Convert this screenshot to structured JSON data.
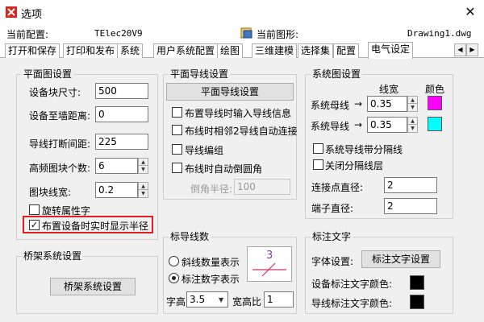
{
  "window": {
    "title": "选项",
    "close_glyph": "✕"
  },
  "info": {
    "current_config_label": "当前配置:",
    "current_config_value": "TElec20V9",
    "current_drawing_label": "当前图形:",
    "current_drawing_value": "Drawing1.dwg"
  },
  "tabs": [
    {
      "label": "打开和保存",
      "active": false
    },
    {
      "label": "打印和发布",
      "active": false
    },
    {
      "label": "系统",
      "active": false
    },
    {
      "label": "用户系统配置",
      "active": false
    },
    {
      "label": "绘图",
      "active": false
    },
    {
      "label": "三维建模",
      "active": false
    },
    {
      "label": "选择集",
      "active": false
    },
    {
      "label": "配置",
      "active": false
    },
    {
      "label": "电气设定",
      "active": true
    }
  ],
  "tab_arrows": {
    "left": "◀",
    "right": "▶"
  },
  "plane": {
    "title": "平面图设置",
    "fields": [
      {
        "label": "设备块尺寸:",
        "value": "500"
      },
      {
        "label": "设备至墙距离:",
        "value": "0"
      },
      {
        "label": "导线打断间距:",
        "value": "225"
      },
      {
        "label": "高频图块个数:",
        "value": "6"
      },
      {
        "label": "图块线宽:",
        "value": "0.2"
      }
    ],
    "rotate_attr": {
      "label": "旋转属性字",
      "checked": false
    },
    "realtime_radius": {
      "label": "布置设备时实时显示半径",
      "checked": true
    }
  },
  "wire": {
    "title": "平面导线设置",
    "button": "平面导线设置",
    "options": [
      {
        "label": "布置导线时输入导线信息",
        "checked": false
      },
      {
        "label": "布线时相邻2导线自动连接",
        "checked": false
      },
      {
        "label": "导线编组",
        "checked": false
      },
      {
        "label": "布线时自动倒圆角",
        "checked": false
      }
    ],
    "chamfer_label": "倒角半径:",
    "chamfer_value": "100"
  },
  "system": {
    "title": "系统图设置",
    "col_width": "线宽",
    "col_color": "颜色",
    "bus": {
      "label": "系统母线",
      "arrow": "→",
      "value": "0.35",
      "color": "#ff00ff"
    },
    "wire": {
      "label": "系统导线",
      "arrow": "→",
      "value": "0.35",
      "color": "#00ffff"
    },
    "separator_opt": {
      "label": "系统导线带分隔线",
      "checked": false
    },
    "close_layer_opt": {
      "label": "关闭分隔线层",
      "checked": false
    },
    "joint_label": "连接点直径:",
    "joint_value": "2",
    "terminal_label": "端子直径:",
    "terminal_value": "2"
  },
  "bridge": {
    "title": "桥架系统设置",
    "button": "桥架系统设置"
  },
  "wirecount": {
    "title": "标导线数",
    "opt_slash": {
      "label": "斜线数量表示",
      "selected": false
    },
    "opt_number": {
      "label": "标注数字表示",
      "selected": true
    },
    "preview_number": "3",
    "height_label": "字高",
    "height_value": "3.5",
    "ratio_label": "宽高比",
    "ratio_value": "1"
  },
  "annotation": {
    "title": "标注文字",
    "font_label": "字体设置:",
    "font_button": "标注文字设置",
    "device_color_label": "设备标注文字颜色:",
    "device_color": "#000000",
    "wire_color_label": "导线标注文字颜色:",
    "wire_color": "#000000"
  },
  "colors": {
    "highlight": "#e02020",
    "preview_line": "#cc3366",
    "preview_text": "#7a3fb0"
  }
}
